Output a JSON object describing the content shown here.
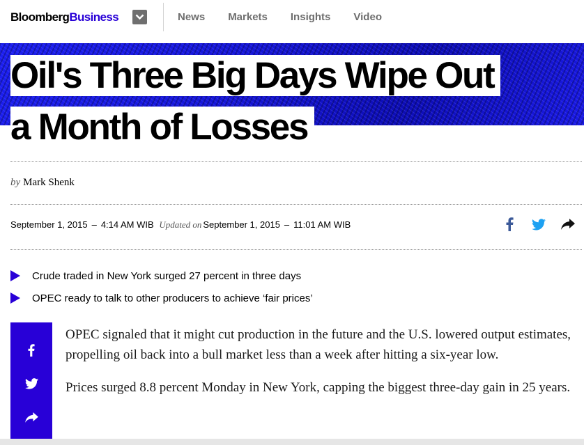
{
  "header": {
    "logo_part1": "Bloomberg",
    "logo_part2": "Business",
    "nav": [
      "News",
      "Markets",
      "Insights",
      "Video"
    ]
  },
  "article": {
    "headline_line1": "Oil's Three Big Days Wipe Out",
    "headline_line2": "a Month of Losses",
    "byline_prefix": "by",
    "author": "Mark Shenk",
    "published": "September 1, 2015",
    "published_time": "4:14 AM WIB",
    "updated_label": "Updated on",
    "updated": "September 1, 2015",
    "updated_time": "11:01 AM WIB",
    "dash": "–",
    "bullets": [
      "Crude traded in New York surged 27 percent in three days",
      "OPEC ready to talk to other producers to achieve ‘fair prices’"
    ],
    "paragraphs": [
      "OPEC signaled that it might cut production in the future and the U.S. lowered output estimates, propelling oil back into a bull market less than a week after hitting a six-year low.",
      "Prices surged 8.8 percent Monday in New York, capping the biggest three-day gain in 25 years."
    ]
  },
  "share_icons": [
    "facebook-icon",
    "twitter-icon",
    "share-arrow-icon"
  ],
  "colors": {
    "brand_blue": "#2800d7",
    "facebook": "#3b5998",
    "twitter": "#1da1f2"
  }
}
